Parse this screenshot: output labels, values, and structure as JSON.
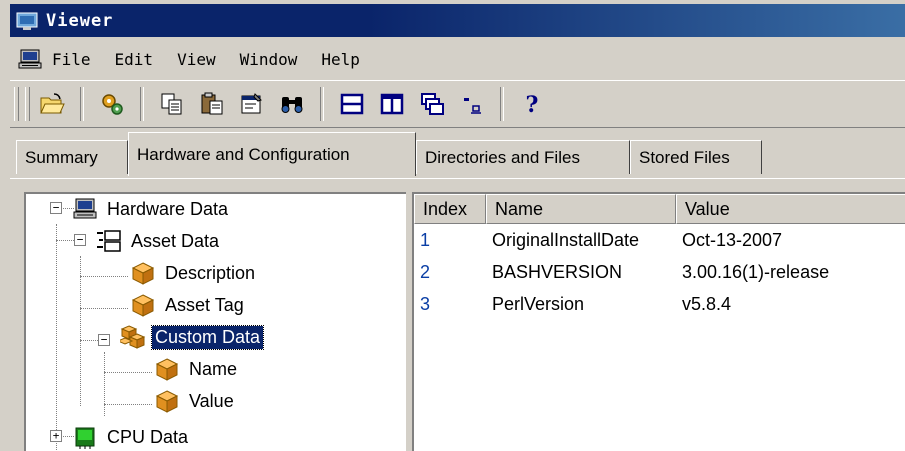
{
  "window": {
    "title": "Viewer"
  },
  "menu": {
    "items": [
      "File",
      "Edit",
      "View",
      "Window",
      "Help"
    ]
  },
  "toolbar": {
    "icons": [
      "open-folder-icon",
      "settings-icon",
      "copy-icon",
      "paste-icon",
      "properties-icon",
      "find-icon",
      "horizontal-split-icon",
      "vertical-split-icon",
      "cascade-icon",
      "small-icons-icon",
      "help-icon"
    ]
  },
  "tabs": [
    {
      "label": "Summary",
      "active": false
    },
    {
      "label": "Hardware and Configuration",
      "active": true
    },
    {
      "label": "Directories and Files",
      "active": false
    },
    {
      "label": "Stored Files",
      "active": false
    }
  ],
  "tree": {
    "nodes": [
      {
        "label": "Hardware Data",
        "expander": "−"
      },
      {
        "label": "Asset Data",
        "expander": "−"
      },
      {
        "label": "Description"
      },
      {
        "label": "Asset Tag"
      },
      {
        "label": "Custom Data",
        "expander": "−",
        "selected": true
      },
      {
        "label": "Name"
      },
      {
        "label": "Value"
      },
      {
        "label": "CPU Data",
        "expander": "+"
      }
    ]
  },
  "list": {
    "columns": [
      "Index",
      "Name",
      "Value"
    ],
    "rows": [
      {
        "index": "1",
        "name": "OriginalInstallDate",
        "value": "Oct-13-2007"
      },
      {
        "index": "2",
        "name": "BASHVERSION",
        "value": "3.00.16(1)-release"
      },
      {
        "index": "3",
        "name": "PerlVersion",
        "value": "v5.8.4"
      }
    ]
  }
}
